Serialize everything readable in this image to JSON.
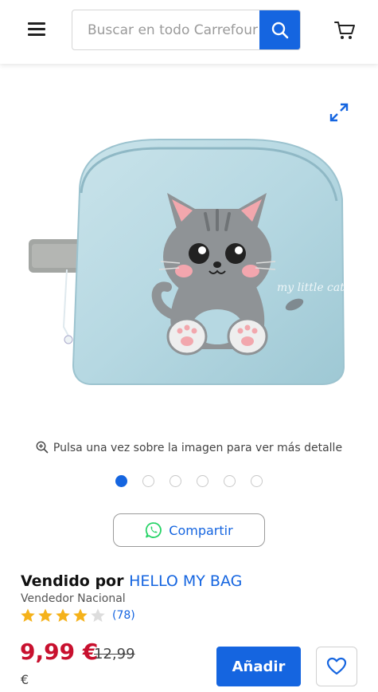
{
  "header": {
    "search_placeholder": "Buscar en todo Carrefour",
    "search_value": ""
  },
  "gallery": {
    "hint": "Pulsa una vez sobre la imagen para ver más detalle",
    "slide_count": 6,
    "active_slide": 1,
    "image_text": "my little cat"
  },
  "share": {
    "label": "Compartir"
  },
  "seller": {
    "prefix": "Vendido por",
    "name": "HELLO MY BAG",
    "type": "Vendedor Nacional",
    "rating": 4,
    "rating_max": 5,
    "review_count": "(78)"
  },
  "pricing": {
    "price": "9,99 €",
    "old_price": "12,99",
    "old_currency": "€"
  },
  "actions": {
    "add_label": "Añadir"
  },
  "colors": {
    "accent": "#1565e0",
    "price": "#c8102e",
    "star": "#f5b21a",
    "whatsapp": "#25d366"
  }
}
